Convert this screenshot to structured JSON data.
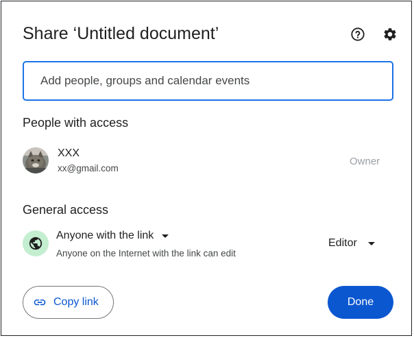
{
  "dialog": {
    "title": "Share ‘Untitled document’",
    "help_icon": "help-circle-icon",
    "settings_icon": "gear-icon"
  },
  "search": {
    "placeholder": "Add people, groups and calendar events"
  },
  "people": {
    "heading": "People with access",
    "items": [
      {
        "name": "XXX",
        "email": "xx@gmail.com",
        "role": "Owner",
        "avatar": "cat-photo-avatar"
      }
    ]
  },
  "general": {
    "heading": "General access",
    "icon": "globe-icon",
    "access_label": "Anyone with the link",
    "access_desc": "Anyone on the Internet with the link can edit",
    "role_label": "Editor"
  },
  "footer": {
    "copy_label": "Copy link",
    "copy_icon": "link-icon",
    "done_label": "Done"
  },
  "colors": {
    "accent": "#0b57d0",
    "focus_border": "#1a73e8",
    "globe_bg": "#c4eed0"
  }
}
